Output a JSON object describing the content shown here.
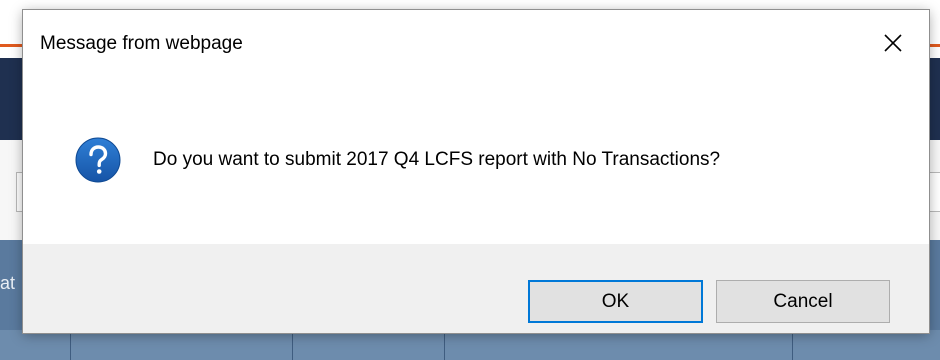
{
  "background_page": {
    "partial_text": "at"
  },
  "dialog": {
    "title": "Message from webpage",
    "message": "Do you want to submit 2017 Q4 LCFS report with No Transactions?",
    "icon": "question-icon",
    "close_icon": "close-icon",
    "buttons": {
      "ok_label": "OK",
      "cancel_label": "Cancel"
    }
  },
  "colors": {
    "question_icon": "#1c64b8",
    "ok_focus_border": "#0078d7",
    "button_face": "#e1e1e1",
    "footer": "#f0f0f0",
    "background_navbar": "#1f3050",
    "background_accent": "#e05a1e",
    "background_grid": "#5a7a9e"
  }
}
